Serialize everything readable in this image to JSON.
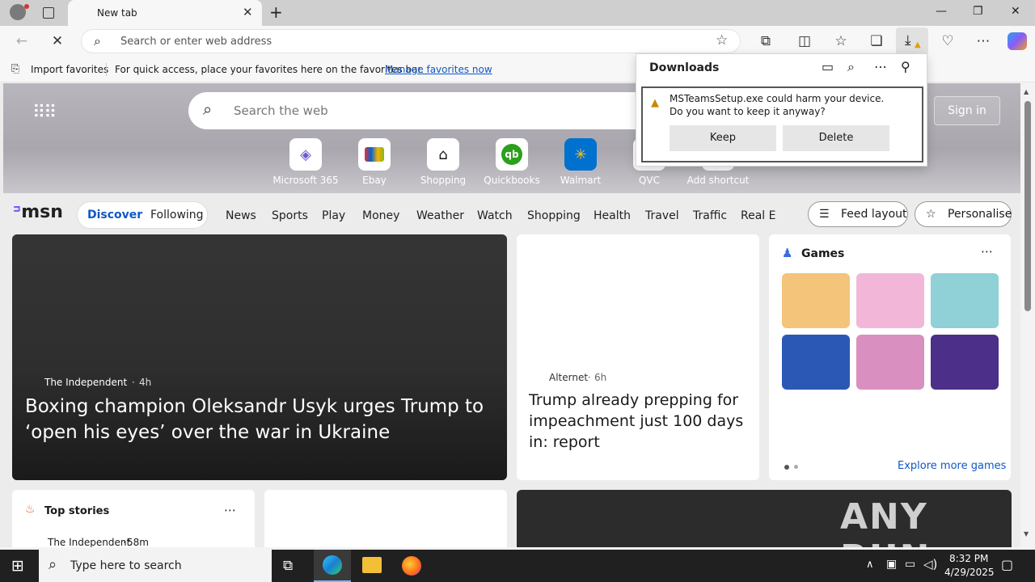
{
  "browser": {
    "tab_title": "New tab",
    "address_placeholder": "Search or enter web address",
    "favbar": {
      "import_label": "Import favorites",
      "hint": "For quick access, place your favorites here on the favorites bar.",
      "manage_link": "Manage favorites now"
    }
  },
  "downloads": {
    "title": "Downloads",
    "warning": "MSTeamsSetup.exe could harm your device. Do you want to keep it anyway?",
    "keep_label": "Keep",
    "delete_label": "Delete"
  },
  "newtab": {
    "search_placeholder": "Search the web",
    "signin_label": "Sign in",
    "shortcuts": [
      {
        "label": "Microsoft 365",
        "icon": "microsoft-365-icon"
      },
      {
        "label": "Ebay",
        "icon": "ebay-icon"
      },
      {
        "label": "Shopping",
        "icon": "shopping-tag-icon"
      },
      {
        "label": "Quickbooks",
        "icon": "quickbooks-icon"
      },
      {
        "label": "Walmart",
        "icon": "walmart-icon"
      },
      {
        "label": "QVC",
        "icon": "qvc-icon"
      },
      {
        "label": "Add shortcut",
        "icon": "plus-icon"
      }
    ]
  },
  "msn": {
    "logo": "msn",
    "tabs": [
      "Discover",
      "Following"
    ],
    "nav": [
      "News",
      "Sports",
      "Play",
      "Money",
      "Weather",
      "Watch",
      "Shopping",
      "Health",
      "Travel",
      "Traffic",
      "Real E"
    ],
    "feed_layout_label": "Feed layout",
    "personalise_label": "Personalise",
    "hero": {
      "source": "The Independent",
      "age": "4h",
      "headline": "Boxing champion Oleksandr Usyk urges Trump to ‘open his eyes’ over the war in Ukraine"
    },
    "mid": {
      "source": "Alternet",
      "age": "6h",
      "headline": "Trump already prepping for impeachment just 100 days in: report"
    },
    "games": {
      "title": "Games",
      "explore_label": "Explore more games",
      "tile_colors": [
        "#f3c47a",
        "#f2b6d9",
        "#8fd1d6",
        "#2b58b5",
        "#d98fbf",
        "#4b2f88"
      ]
    },
    "top_stories": {
      "title": "Top stories",
      "source": "The Independent",
      "age": "58m"
    },
    "watermark": "ANY RUN"
  },
  "taskbar": {
    "search_placeholder": "Type here to search",
    "time": "8:32 PM",
    "date": "4/29/2025"
  },
  "colors": {
    "accent": "#0f58c5",
    "taskbar": "#202020"
  }
}
